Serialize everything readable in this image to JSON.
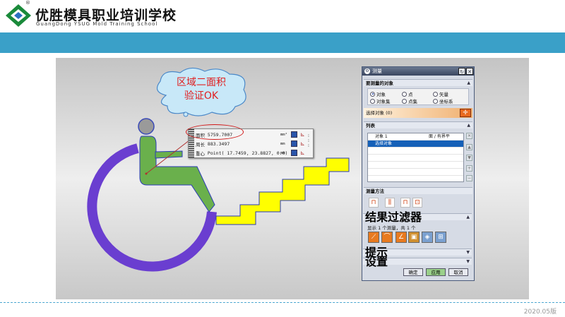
{
  "header": {
    "school_name": "优胜模具职业培训学校",
    "school_name_en": "GuangDong YSUG Mold Training School",
    "registered_mark": "®"
  },
  "colors": {
    "band": "#3aa0c8",
    "figure_green": "#6ab04c",
    "wheel_purple": "#6a3ed0",
    "stairs_yellow": "#ffff00",
    "callout_red": "#e02020"
  },
  "callout": {
    "line1": "区域二面积",
    "line2": "验证OK"
  },
  "measure_box": {
    "rows": [
      {
        "label": "面积",
        "value": "5759.7007",
        "unit": "mm²"
      },
      {
        "label": "周长",
        "value": "883.3497",
        "unit": "mm"
      },
      {
        "label": "重心",
        "value": "Point( 17.7459, 23.8827, 0.0)",
        "unit": "mm"
      }
    ]
  },
  "dialog": {
    "title": "测量",
    "objects_section": "要测量的对象",
    "radios": [
      {
        "label": "对象",
        "checked": true
      },
      {
        "label": "点",
        "checked": false
      },
      {
        "label": "矢量",
        "checked": false
      },
      {
        "label": "对象集",
        "checked": false
      },
      {
        "label": "点集",
        "checked": false
      },
      {
        "label": "坐标系",
        "checked": false
      }
    ],
    "select_label": "选择对象 (0)",
    "list_section": "列表",
    "list_rows": [
      {
        "label": "对象 1",
        "col": "面 / 有界平"
      },
      {
        "label": "选择对象",
        "col": "",
        "selected": true
      }
    ],
    "method_section": "测量方法",
    "filter_section": "结果过滤器",
    "filter_status": "显示 1 个测量，共 1 个",
    "hints_section": "提示",
    "settings_section": "设置",
    "buttons": {
      "ok": "确定",
      "apply": "应用",
      "cancel": "取消"
    }
  },
  "footer": {
    "version": "2020.05版"
  }
}
